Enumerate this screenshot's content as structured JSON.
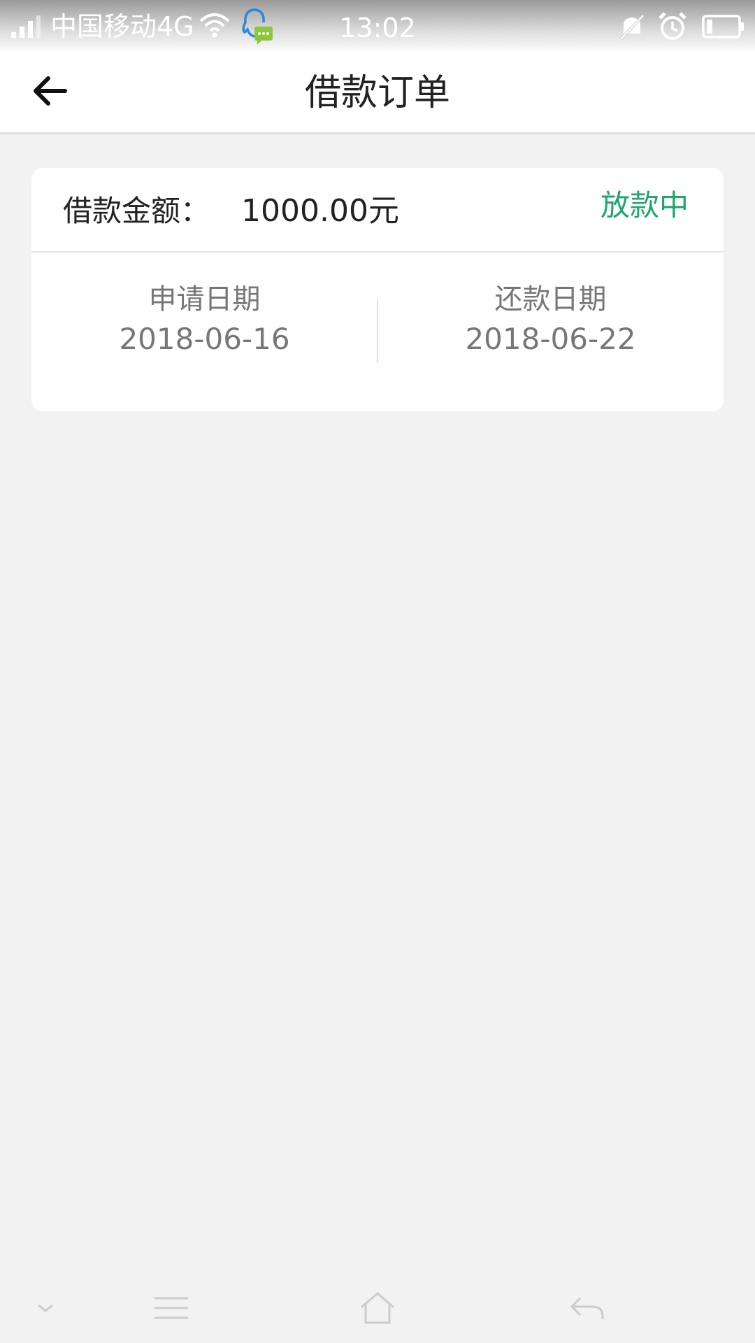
{
  "status_bar": {
    "carrier": "中国移动4G",
    "time": "13:02",
    "icons": [
      "signal-icon",
      "wifi-icon",
      "qq-notification-icon",
      "mute-icon",
      "alarm-icon",
      "battery-icon"
    ]
  },
  "header": {
    "title": "借款订单",
    "back_icon": "arrow-left-icon"
  },
  "order": {
    "amount_label": "借款金额：",
    "amount_value": "1000.00元",
    "status": "放款中",
    "apply_date_label": "申请日期",
    "apply_date": "2018-06-16",
    "repay_date_label": "还款日期",
    "repay_date": "2018-06-22"
  },
  "nav_bar": {
    "icons": [
      "chevron-down-icon",
      "menu-icon",
      "home-icon",
      "back-icon"
    ]
  },
  "colors": {
    "status_green": "#1fa66a",
    "background": "#f2f2f2",
    "card": "#ffffff"
  }
}
